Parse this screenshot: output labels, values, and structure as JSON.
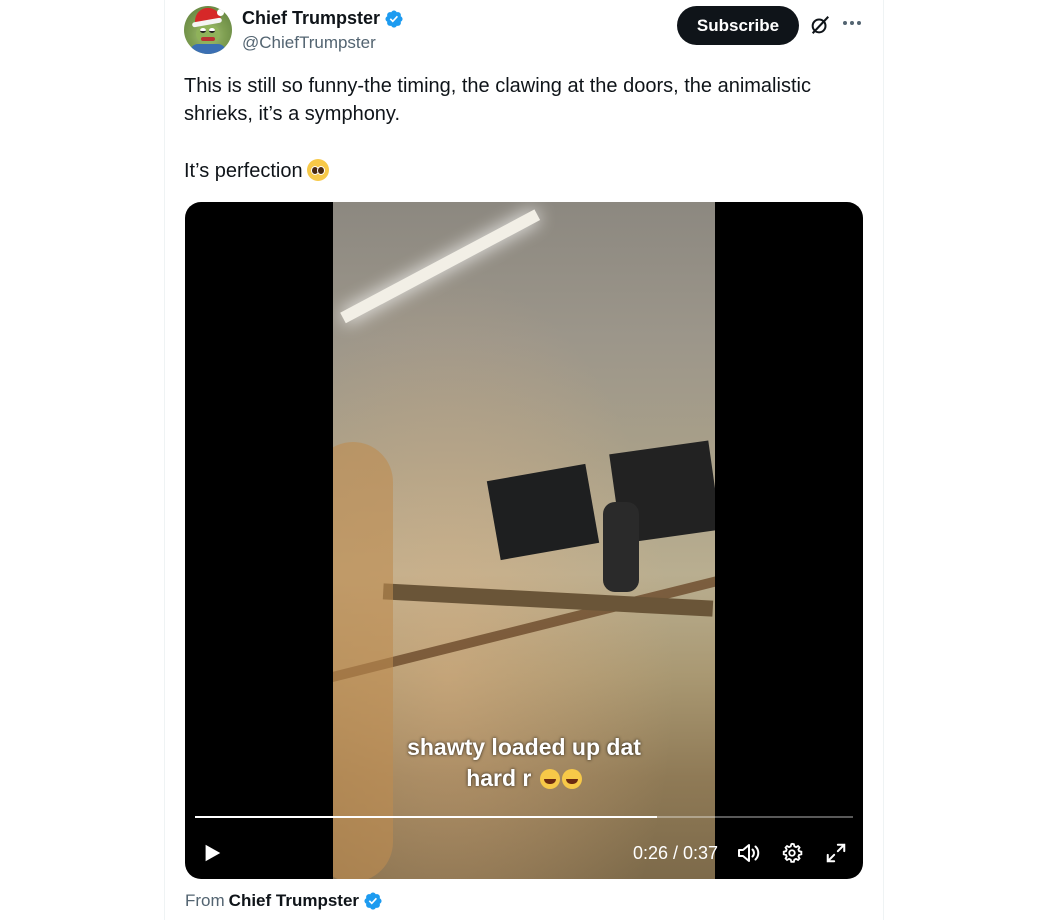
{
  "author": {
    "display_name": "Chief Trumpster",
    "handle": "@ChiefTrumpster",
    "verified": true
  },
  "actions": {
    "subscribe_label": "Subscribe"
  },
  "icons": {
    "verified": "verified-badge-icon",
    "grok": "grok-icon",
    "more": "more-options-icon",
    "play": "play-icon",
    "volume": "volume-icon",
    "settings": "settings-gear-icon",
    "fullscreen": "fullscreen-icon"
  },
  "tweet": {
    "paragraph_1": "This is still so funny-the timing, the clawing at the doors, the animalistic shrieks, it’s a symphony.",
    "paragraph_2": "It’s perfection"
  },
  "video": {
    "caption_line_1": "shawty loaded up dat",
    "caption_line_2": "hard r",
    "timecode": "0:26 / 0:37",
    "progress": 0.7027
  },
  "from": {
    "label": "From",
    "name": "Chief Trumpster"
  },
  "colors": {
    "accent_blue": "#1d9bf0",
    "text_primary": "#0f1419",
    "text_secondary": "#536471",
    "button_dark": "#0f1419"
  }
}
